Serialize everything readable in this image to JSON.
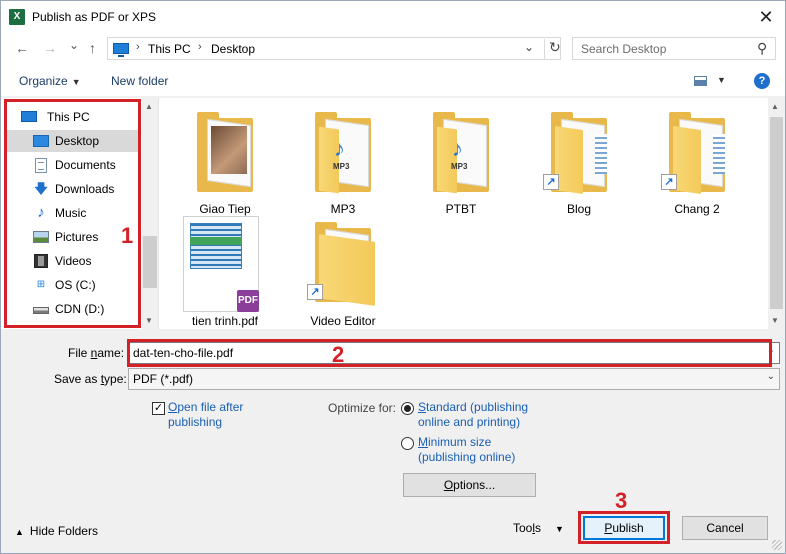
{
  "window": {
    "title": "Publish as PDF or XPS",
    "app_icon": "X",
    "close_glyph": "✕"
  },
  "nav": {
    "back_glyph": "←",
    "forward_glyph": "→",
    "recent_glyph": "⌄",
    "up_glyph": "↑",
    "breadcrumb": [
      "This PC",
      "Desktop"
    ],
    "breadcrumb_sep": "›",
    "search_placeholder": "Search Desktop"
  },
  "toolbar": {
    "organize": "Organize",
    "new_folder": "New folder",
    "help": "?"
  },
  "sidebar": {
    "items": [
      {
        "label": "This PC",
        "icon": "computer-icon"
      },
      {
        "label": "Desktop",
        "icon": "desktop-icon",
        "selected": true
      },
      {
        "label": "Documents",
        "icon": "documents-icon"
      },
      {
        "label": "Downloads",
        "icon": "downloads-icon"
      },
      {
        "label": "Music",
        "icon": "music-icon"
      },
      {
        "label": "Pictures",
        "icon": "pictures-icon"
      },
      {
        "label": "Videos",
        "icon": "videos-icon"
      },
      {
        "label": "OS (C:)",
        "icon": "windows-drive-icon"
      },
      {
        "label": "CDN (D:)",
        "icon": "drive-icon"
      }
    ]
  },
  "files": [
    {
      "name": "Giao Tiep",
      "type": "folder",
      "icon": "photo-folder-icon"
    },
    {
      "name": "MP3",
      "type": "folder",
      "icon": "music-folder-icon",
      "badge": "MP3"
    },
    {
      "name": "PTBT",
      "type": "folder",
      "icon": "music-folder-icon",
      "badge": "MP3"
    },
    {
      "name": "Blog",
      "type": "folder-shortcut",
      "icon": "folder-shortcut-icon"
    },
    {
      "name": "Chang 2",
      "type": "folder-shortcut",
      "icon": "folder-shortcut-icon"
    },
    {
      "name": "tien trinh.pdf",
      "type": "pdf",
      "icon": "pdf-file-icon",
      "badge": "PDF"
    },
    {
      "name": "Video Editor",
      "type": "folder-shortcut",
      "icon": "folder-shortcut-icon"
    }
  ],
  "form": {
    "file_name_label_prefix": "File ",
    "file_name_label_key": "n",
    "file_name_label_suffix": "ame:",
    "file_name_value": "dat-ten-cho-file.pdf",
    "save_type_label_prefix": "Save as ",
    "save_type_label_key": "t",
    "save_type_label_suffix": "ype:",
    "save_type_value": "PDF (*.pdf)",
    "open_after_line1_key": "O",
    "open_after_line1": "pen file after",
    "open_after_line2": "publishing",
    "open_after_checked": true,
    "optimize_label": "Optimize for:",
    "standard_key": "S",
    "standard_line1": "tandard (publishing",
    "standard_line2": "online and printing)",
    "minimum_key": "M",
    "minimum_line1": "inimum size",
    "minimum_line2": "(publishing online)",
    "options_key": "O",
    "options_rest": "ptions..."
  },
  "footer": {
    "hide_folders": "Hide Folders",
    "tools_prefix": "Too",
    "tools_key": "l",
    "tools_suffix": "s",
    "publish_key": "P",
    "publish_rest": "ublish",
    "cancel": "Cancel"
  },
  "annotations": {
    "n1": "1",
    "n2": "2",
    "n3": "3",
    "color": "#d42027"
  }
}
